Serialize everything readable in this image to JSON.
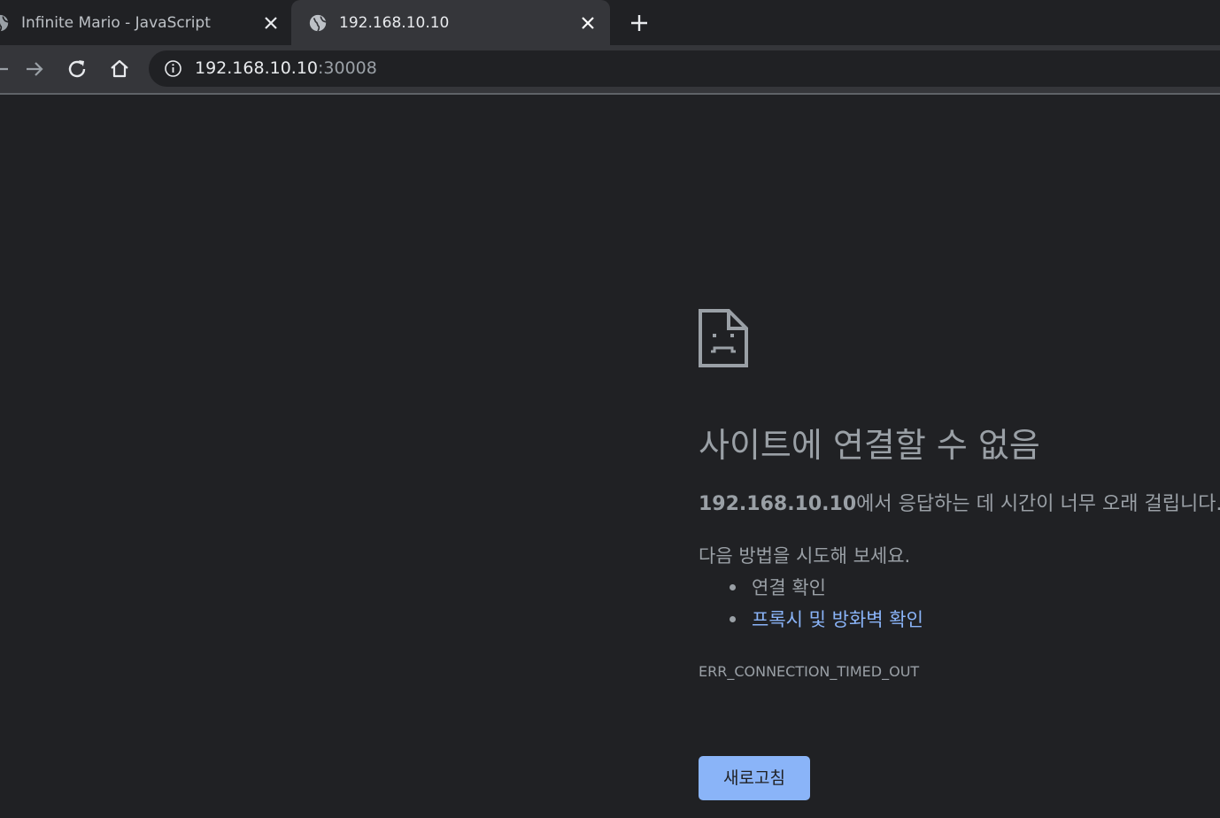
{
  "tabs": [
    {
      "title": "Infinite Mario - JavaScript",
      "icon": "globe-icon",
      "active": false
    },
    {
      "title": "192.168.10.10",
      "icon": "globe-icon",
      "active": true
    }
  ],
  "toolbar": {
    "url_host": "192.168.10.10",
    "url_port": ":30008"
  },
  "error_page": {
    "title": "사이트에 연결할 수 없음",
    "summary_host": "192.168.10.10",
    "summary_text": "에서 응답하는 데 시간이 너무 오래 걸립니다.",
    "suggestions_heading": "다음 방법을 시도해 보세요.",
    "suggestions": [
      {
        "text": "연결 확인",
        "is_link": false
      },
      {
        "text": "프록시 및 방화벽 확인",
        "is_link": true
      }
    ],
    "error_code": "ERR_CONNECTION_TIMED_OUT",
    "reload_label": "새로고침"
  },
  "colors": {
    "background": "#202124",
    "toolbar": "#35363a",
    "text_muted": "#9aa0a6",
    "link": "#8ab4f8",
    "button": "#8ab4f8"
  }
}
